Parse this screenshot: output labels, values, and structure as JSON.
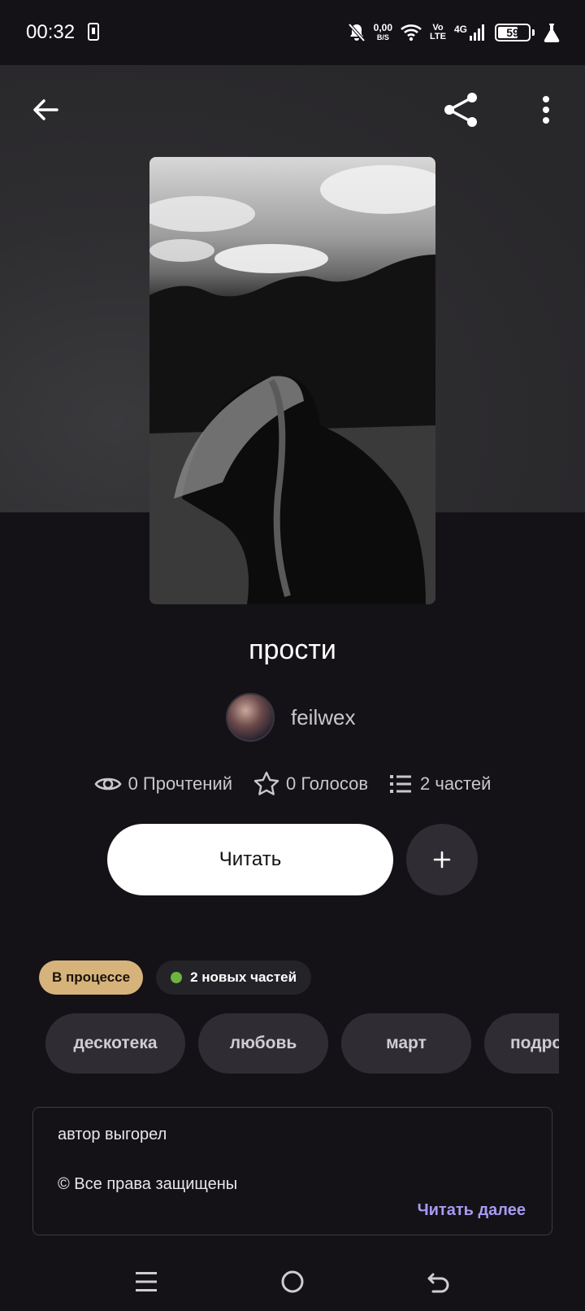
{
  "status_bar": {
    "time": "00:32",
    "net_speed_value": "0,00",
    "net_speed_unit": "B/S",
    "volte_top": "Vo",
    "volte_bottom": "LTE",
    "network": "4G",
    "battery": "59"
  },
  "story": {
    "title": "прости",
    "author": "feilwex",
    "stats": {
      "reads": "0 Прочтений",
      "votes": "0 Голосов",
      "parts": "2 частей"
    },
    "read_button": "Читать",
    "add_button": "+",
    "status_badge": "В процессе",
    "new_parts_badge": "2 новых частей",
    "tags": [
      "дескотека",
      "любовь",
      "март",
      "подро"
    ],
    "description": {
      "line1": "автор выгорел",
      "line2": "© Все права защищены",
      "read_more": "Читать далее"
    }
  },
  "icons": {
    "back": "arrow-left-icon",
    "share": "share-icon",
    "more": "more-vertical-icon",
    "eye": "eye-icon",
    "star": "star-icon",
    "list": "list-icon"
  },
  "colors": {
    "background": "#141216",
    "status_badge": "#d7b37c",
    "new_dot": "#6cb33f",
    "read_more": "#a79bf2"
  }
}
